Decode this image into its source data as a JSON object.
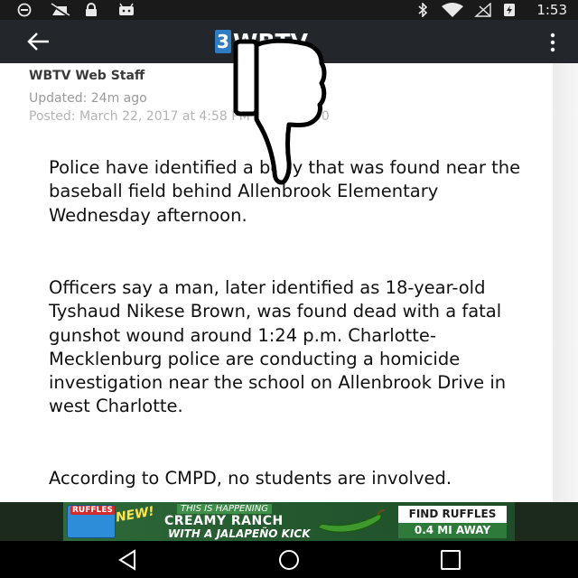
{
  "status_bar": {
    "time": "1:53",
    "icons": [
      "do-not-disturb-icon",
      "no-sim-icon",
      "lock-icon",
      "android-icon",
      "bluetooth-icon",
      "wifi-icon",
      "no-signal-icon",
      "battery-charging-icon"
    ]
  },
  "app_bar": {
    "logo_badge": "3",
    "logo_text": "WBTV",
    "back_icon": "back-arrow-icon",
    "menu_icon": "overflow-menu-icon"
  },
  "article": {
    "author": "WBTV Web Staff",
    "updated": "Updated: 24m ago",
    "posted": "Posted: March 22, 2017 at 4:58 PM GMT+00:00",
    "paragraphs": [
      "Police have identified a body that was found near the baseball field behind Allenbrook Elementary Wednesday afternoon.",
      "Officers say a man, later identified as 18-year-old Tyshaud Nikese Brown, was found dead with a fatal gunshot wound around 1:24 p.m. Charlotte-Mecklenburg police are conducting a homicide investigation near the school on Allenbrook Drive in west Charlotte.",
      "According to CMPD, no students are involved."
    ]
  },
  "overlay": {
    "icon": "thumbs-down-icon"
  },
  "ad": {
    "brand": "RUFFLES",
    "new_label": "NEW!",
    "tagline": "THIS IS HAPPENING",
    "headline": "CREAMY RANCH",
    "subline": "WITH A JALAPEÑO KICK",
    "cta_top": "FIND RUFFLES",
    "cta_bottom": "0.4 MI AWAY"
  },
  "nav_bar": {
    "buttons": [
      "back-triangle-icon",
      "home-circle-icon",
      "recents-square-icon"
    ]
  }
}
